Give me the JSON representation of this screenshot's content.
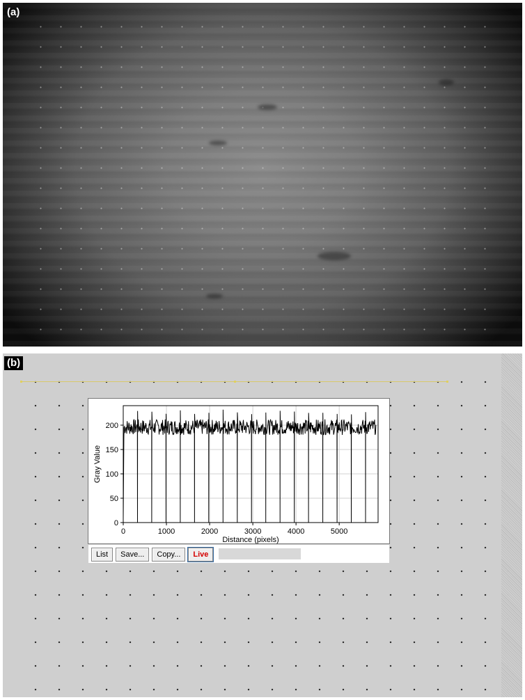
{
  "panels": {
    "a": {
      "label": "(a)"
    },
    "b": {
      "label": "(b)"
    }
  },
  "plot_window": {
    "buttons": {
      "list": "List",
      "save": "Save...",
      "copy": "Copy...",
      "live": "Live"
    }
  },
  "chart_data": {
    "type": "line",
    "xlabel": "Distance (pixels)",
    "ylabel": "Gray Value",
    "xlim": [
      0,
      5900
    ],
    "ylim": [
      0,
      240
    ],
    "x_ticks": [
      0,
      1000,
      2000,
      3000,
      4000,
      5000
    ],
    "y_ticks": [
      0,
      50,
      100,
      150,
      200
    ],
    "grid": true,
    "baseline_level": 195,
    "baseline_noise_range": [
      180,
      212
    ],
    "dip_positions": [
      330,
      660,
      990,
      1320,
      1650,
      1980,
      2310,
      2640,
      2970,
      3300,
      3630,
      3960,
      4290,
      4620,
      4950,
      5280,
      5610
    ],
    "dip_min": 0,
    "spike_max": 232,
    "colors": {
      "line": "#000000",
      "grid": "#d0d0d0",
      "live": "#d40000"
    }
  }
}
